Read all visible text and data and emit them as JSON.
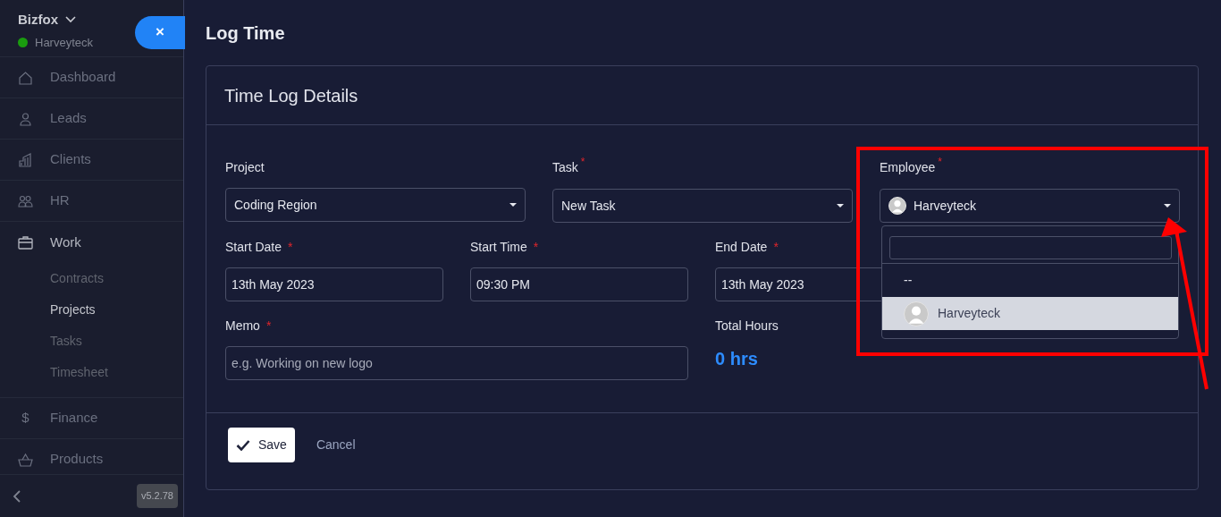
{
  "sidebar": {
    "workspace": "Bizfox",
    "user": "Harveyteck",
    "online": true,
    "items": [
      {
        "label": "Dashboard",
        "selected": false
      },
      {
        "label": "Leads",
        "selected": false
      },
      {
        "label": "Clients",
        "selected": false
      },
      {
        "label": "HR",
        "selected": false
      },
      {
        "label": "Work",
        "selected": true,
        "children": [
          {
            "label": "Contracts",
            "selected": false
          },
          {
            "label": "Projects",
            "selected": true
          },
          {
            "label": "Tasks",
            "selected": false
          },
          {
            "label": "Timesheet",
            "selected": false
          }
        ]
      },
      {
        "label": "Finance",
        "icon_text": "$",
        "selected": false
      },
      {
        "label": "Products",
        "selected": false
      }
    ],
    "version": "v5.2.78"
  },
  "close_button": "×",
  "page": {
    "title": "Log Time",
    "card_title": "Time Log Details",
    "rows": [
      [
        {
          "kind": "select",
          "label": "Project",
          "value": "Coding Region"
        },
        {
          "kind": "select",
          "label": "Task",
          "required_mark": "*",
          "value": "New Task"
        },
        {
          "kind": "user-select",
          "label": "Employee",
          "required_mark": "*",
          "value": "Harveyteck",
          "open": true,
          "options": [
            {
              "kind": "blank",
              "label": "--",
              "selected": false
            },
            {
              "kind": "user",
              "label": "Harveyteck",
              "selected": true
            }
          ]
        }
      ],
      [
        {
          "kind": "input",
          "label": "Start Date",
          "required_mark": "*",
          "value": "13th May 2023"
        },
        {
          "kind": "input",
          "label": "Start Time",
          "required_mark": "*",
          "value": "09:30 PM"
        },
        {
          "kind": "input",
          "label": "End Date",
          "required_mark": "*",
          "value": "13th May 2023"
        }
      ],
      [
        {
          "kind": "wide-input",
          "label": "Memo",
          "required_mark": "*",
          "placeholder": "e.g. Working on new logo"
        },
        {
          "kind": "total",
          "label": "Total Hours",
          "value": "0 hrs"
        }
      ]
    ],
    "save_button": "Save",
    "cancel_button": "Cancel"
  }
}
